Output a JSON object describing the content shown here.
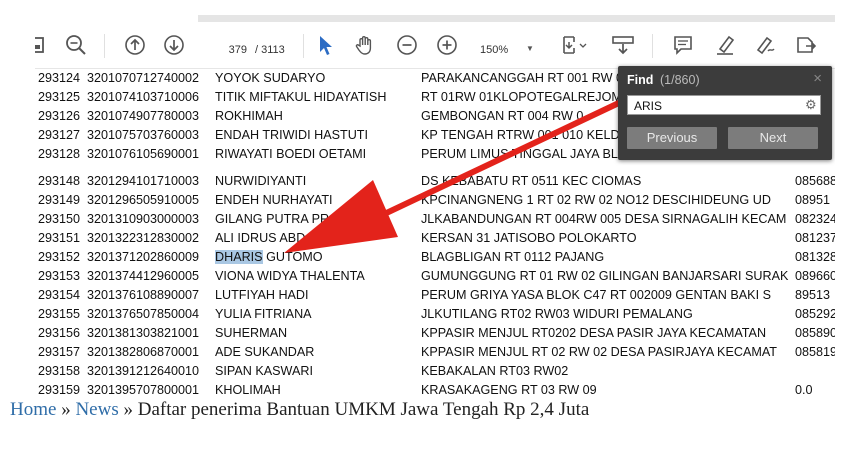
{
  "toolbar": {
    "page_current": "379",
    "page_total": "/ 3113",
    "zoom": "150%",
    "icons": [
      "save-icon",
      "zoom-out-magnifier-icon",
      "prev-page-icon",
      "next-page-icon",
      "select-cursor-icon",
      "hand-tool-icon",
      "zoom-minus-icon",
      "zoom-plus-icon",
      "fit-page-icon",
      "scroll-mode-icon",
      "comment-icon",
      "highlight-pen-icon",
      "sign-icon",
      "stamp-icon"
    ]
  },
  "rows": [
    {
      "no": "293124",
      "nik": "3201070712740002",
      "name": "YOYOK SUDARYO",
      "addr": "PARAKANCANGGAH RT 001 RW 0",
      "phone": ""
    },
    {
      "no": "293125",
      "nik": "3201074103710006",
      "name": "TITIK MIFTAKUL HIDAYATISH",
      "addr": "RT 01RW 01KLOPOTEGALREJOMA",
      "phone": ""
    },
    {
      "no": "293126",
      "nik": "3201074907780003",
      "name": "ROKHIMAH",
      "addr": "GEMBONGAN RT 004 RW 0",
      "phone": ""
    },
    {
      "no": "293127",
      "nik": "3201075703760003",
      "name": "ENDAH TRIWIDI HASTUTI",
      "addr": "KP TENGAH RTRW 001 010 KELDE",
      "phone": ""
    },
    {
      "no": "293128",
      "nik": "3201076105690001",
      "name": "RIWAYATI BOEDI OETAMI",
      "addr": "PERUM LIMUS TINGGAL JAYA BL",
      "phone": ""
    },
    {
      "no": "293148",
      "nik": "3201294101710003",
      "name": "NURWIDIYANTI",
      "addr": "DS KEBABATU RT 0511 KEC CIOMAS",
      "phone": "085688"
    },
    {
      "no": "293149",
      "nik": "3201296505910005",
      "name": "ENDEH NURHAYATI",
      "addr": "KPCINANGNENG 1 RT 02 RW 02 NO12 DESCIHIDEUNG UD",
      "phone": "08951"
    },
    {
      "no": "293150",
      "nik": "3201310903000003",
      "name": "GILANG PUTRA PRA",
      "addr": "JLKABANDUNGAN RT 004RW 005 DESA SIRNAGALIH KECAM",
      "phone": "082324"
    },
    {
      "no": "293151",
      "nik": "3201322312830002",
      "name": "ALI IDRUS ABD",
      "addr": "KERSAN 31 JATISOBO POLOKARTO",
      "phone": "081237"
    },
    {
      "no": "293152",
      "nik": "3201371202860009",
      "name_hl": "DHARIS",
      "name_rest": " GUTOMO",
      "addr": "BLAGBLIGAN RT 0112 PAJANG",
      "phone": "081328"
    },
    {
      "no": "293153",
      "nik": "3201374412960005",
      "name": "VIONA WIDYA THALENTA",
      "addr": "GUMUNGGUNG RT 01 RW 02 GILINGAN BANJARSARI SURAK",
      "phone": "089660"
    },
    {
      "no": "293154",
      "nik": "3201376108890007",
      "name": "LUTFIYAH HADI",
      "addr": "PERUM GRIYA YASA BLOK C47 RT 002009 GENTAN BAKI S",
      "phone": "89513"
    },
    {
      "no": "293155",
      "nik": "3201376507850004",
      "name": "YULIA FITRIANA",
      "addr": "JLKUTILANG RT02 RW03 WIDURI PEMALANG",
      "phone": "085292"
    },
    {
      "no": "293156",
      "nik": "3201381303821001",
      "name": "SUHERMAN",
      "addr": "KPPASIR MENJUL RT0202 DESA PASIR JAYA KECAMATAN",
      "phone": "085890"
    },
    {
      "no": "293157",
      "nik": "3201382806870001",
      "name": "ADE SUKANDAR",
      "addr": "KPPASIR MENJUL RT 02 RW 02 DESA PASIRJAYA KECAMAT",
      "phone": "085819"
    },
    {
      "no": "293158",
      "nik": "3201391212640010",
      "name": "SIPAN KASWARI",
      "addr": "KEBAKALAN RT03 RW02",
      "phone": ""
    },
    {
      "no": "293159",
      "nik": "3201395707800001",
      "name": "KHOLIMAH",
      "addr": "KRASAKAGENG RT 03 RW 09",
      "phone": "0.0"
    }
  ],
  "find": {
    "title": "Find",
    "count": "(1/860)",
    "query": "ARIS",
    "close": "×",
    "previous": "Previous",
    "next": "Next"
  },
  "arrow_color": "#e3231b",
  "highlight_color": "#a9c7e3",
  "breadcrumb": {
    "home": "Home",
    "sep1": " » ",
    "news": "News",
    "sep2": " » ",
    "current": "Daftar penerima Bantuan UMKM Jawa Tengah Rp 2,4 Juta"
  }
}
